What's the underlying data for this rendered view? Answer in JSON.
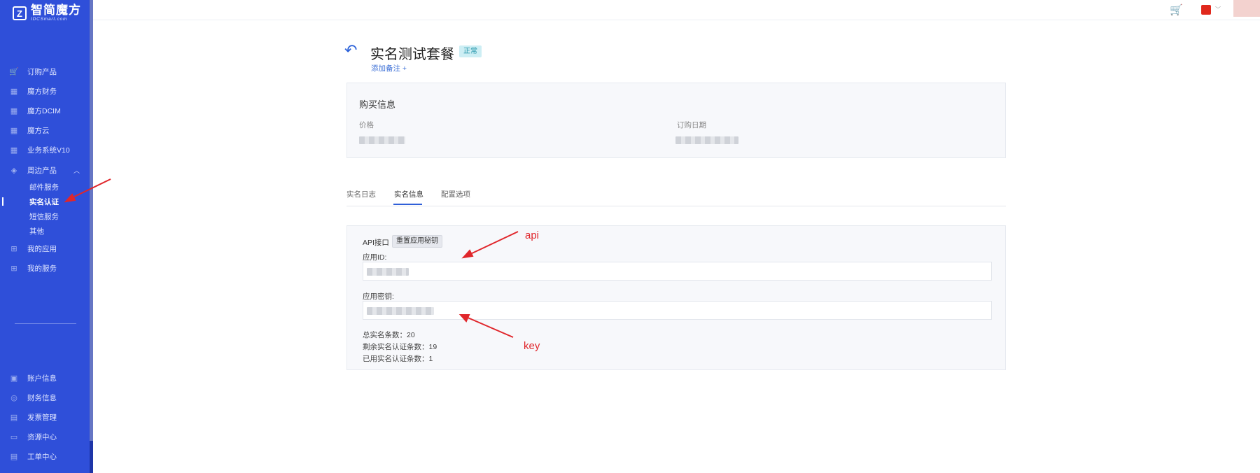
{
  "sidebar": {
    "logo_cn": "智简魔方",
    "logo_en": "IDCSmart.com",
    "logo_mark": "Z",
    "items": [
      {
        "label": "订购产品",
        "icon": "cart-icon"
      },
      {
        "label": "魔方财务",
        "icon": "grid-icon"
      },
      {
        "label": "魔方DCIM",
        "icon": "grid-icon"
      },
      {
        "label": "魔方云",
        "icon": "grid-icon"
      },
      {
        "label": "业务系统V10",
        "icon": "grid-icon"
      },
      {
        "label": "周边产品",
        "icon": "cube-icon"
      }
    ],
    "sub_items": [
      {
        "label": "邮件服务"
      },
      {
        "label": "实名认证"
      },
      {
        "label": "短信服务"
      },
      {
        "label": "其他"
      }
    ],
    "more_items": [
      {
        "label": "我的应用",
        "icon": "apps-icon"
      },
      {
        "label": "我的服务",
        "icon": "apps-icon"
      }
    ],
    "bottom_items": [
      {
        "label": "账户信息",
        "icon": "user-icon"
      },
      {
        "label": "财务信息",
        "icon": "coin-icon"
      },
      {
        "label": "发票管理",
        "icon": "invoice-icon"
      },
      {
        "label": "资源中心",
        "icon": "folder-icon"
      },
      {
        "label": "工单中心",
        "icon": "ticket-icon"
      }
    ]
  },
  "page": {
    "title": "实名测试套餐",
    "status": "正常",
    "add_remark": "添加备注 +"
  },
  "purchase": {
    "title": "购买信息",
    "price_label": "价格",
    "date_label": "订购日期"
  },
  "tabs": [
    "实名日志",
    "实名信息",
    "配置选项"
  ],
  "api": {
    "label": "API接口",
    "reset_button": "重置应用秘钥",
    "app_id_label": "应用ID:",
    "app_secret_label": "应用密钥:",
    "stats": [
      "总实名条数：20",
      "剩余实名认证条数：19",
      "已用实名认证条数：1"
    ]
  },
  "annotations": {
    "api": "api",
    "key": "key"
  },
  "colors": {
    "sidebar": "#2f4fd9",
    "accent": "#2f5fd8",
    "badge_bg": "#cdeef4",
    "annotation": "#e0262b"
  }
}
